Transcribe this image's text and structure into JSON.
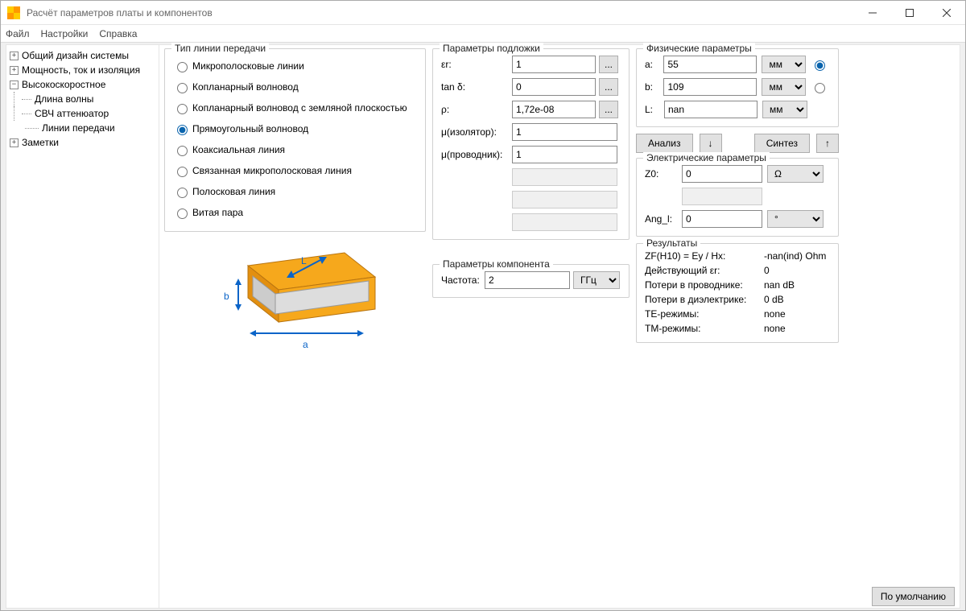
{
  "window": {
    "title": "Расчёт параметров платы и компонентов"
  },
  "menu": {
    "file": "Файл",
    "settings": "Настройки",
    "help": "Справка"
  },
  "tree": {
    "n1": "Общий дизайн системы",
    "n2": "Мощность, ток и изоляция",
    "n3": "Высокоскоростное",
    "n3a": "Длина волны",
    "n3b": "СВЧ аттенюатор",
    "n3c": "Линии передачи",
    "n4": "Заметки"
  },
  "line_type": {
    "legend": "Тип линии передачи",
    "microstrip": "Микрополосковые линии",
    "cpw": "Копланарный волновод",
    "cpwg": "Копланарный волновод с земляной плоскостью",
    "rect": "Прямоугольный волновод",
    "coax": "Коаксиальная линия",
    "coupled": "Связанная микрополосковая линия",
    "stripline": "Полосковая линия",
    "twisted": "Витая пара"
  },
  "substrate": {
    "legend": "Параметры подложки",
    "er_label": "εr:",
    "er": "1",
    "tand_label": "tan δ:",
    "tand": "0",
    "rho_label": "ρ:",
    "rho": "1,72e-08",
    "mu_i_label": "μ(изолятор):",
    "mu_i": "1",
    "mu_c_label": "μ(проводник):",
    "mu_c": "1"
  },
  "component": {
    "legend": "Параметры компонента",
    "freq_label": "Частота:",
    "freq": "2",
    "freq_unit": "ГГц"
  },
  "phys": {
    "legend": "Физические параметры",
    "a_label": "a:",
    "a": "55",
    "b_label": "b:",
    "b": "109",
    "l_label": "L:",
    "l": "nan",
    "unit": "мм"
  },
  "actions": {
    "analyze": "Анализ",
    "synth": "Синтез"
  },
  "elec": {
    "legend": "Электрические параметры",
    "z0_label": "Z0:",
    "z0": "0",
    "z0_unit": "Ω",
    "ang_label": "Ang_l:",
    "ang": "0",
    "ang_unit": "°"
  },
  "results": {
    "legend": "Результаты",
    "r1k": "ZF(H10) = Ey / Hx:",
    "r1v": "-nan(ind) Ohm",
    "r2k": "Действующий εr:",
    "r2v": "0",
    "r3k": "Потери в проводнике:",
    "r3v": "nan dB",
    "r4k": "Потери в диэлектрике:",
    "r4v": "0 dB",
    "r5k": "TE-режимы:",
    "r5v": "none",
    "r6k": "TM-режимы:",
    "r6v": "none"
  },
  "footer": {
    "default_btn": "По умолчанию"
  }
}
